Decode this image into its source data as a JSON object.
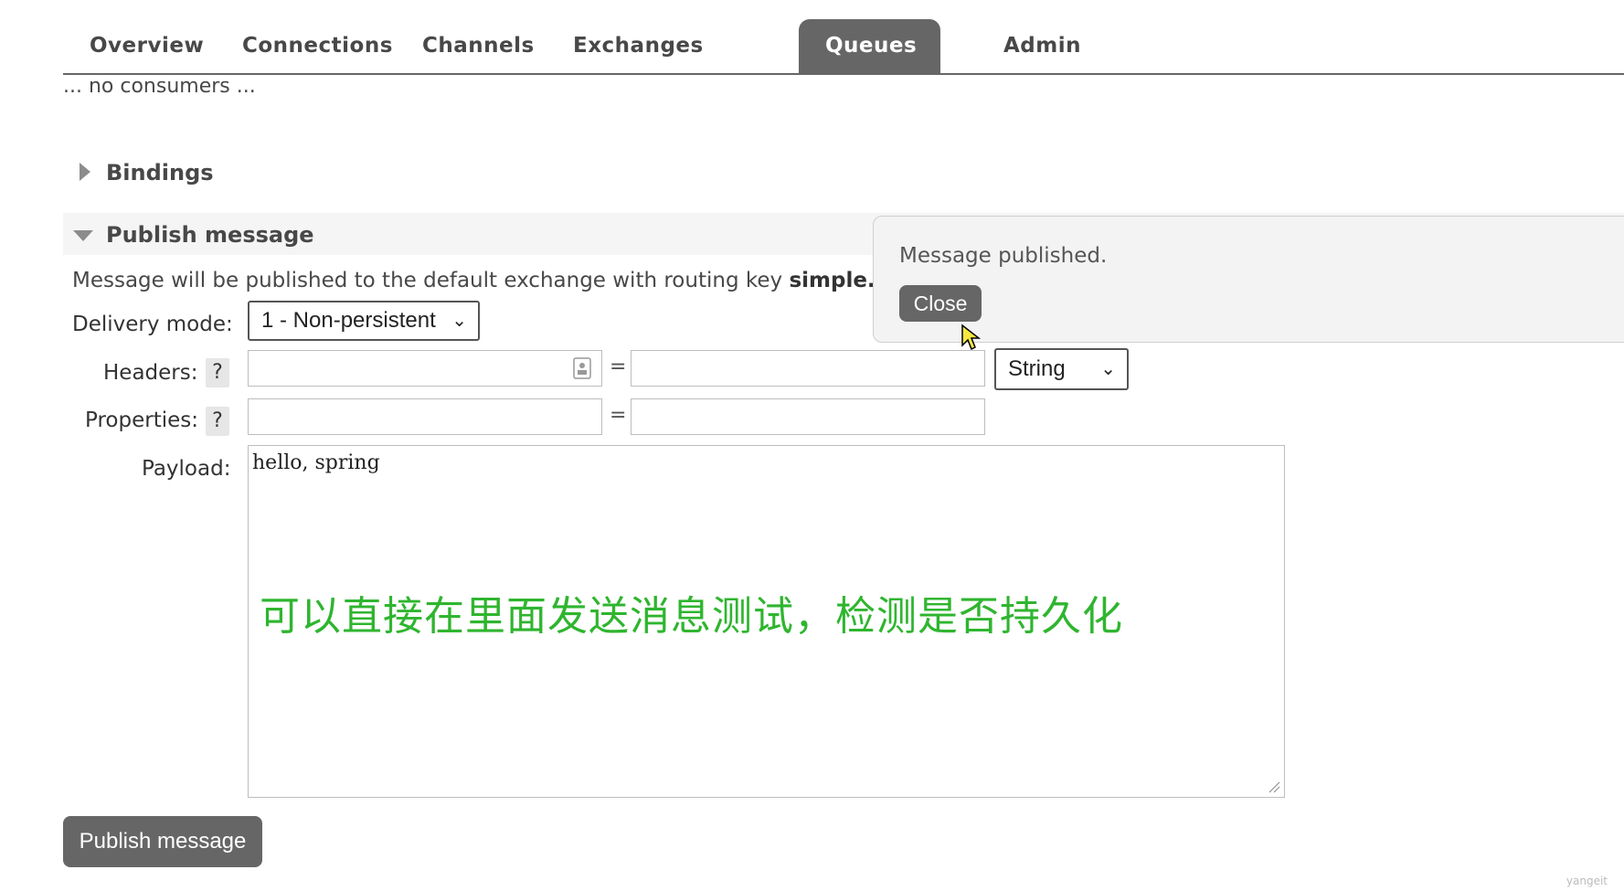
{
  "tabs": [
    {
      "label": "Overview"
    },
    {
      "label": "Connections"
    },
    {
      "label": "Channels"
    },
    {
      "label": "Exchanges"
    },
    {
      "label": "Queues",
      "active": true
    },
    {
      "label": "Admin"
    }
  ],
  "consumers_text": "... no consumers ...",
  "bindings_title": "Bindings",
  "publish": {
    "title": "Publish message",
    "info_prefix": "Message will be published to the default exchange with routing key ",
    "routing_key": "simple.q",
    "delivery_mode_label": "Delivery mode:",
    "delivery_mode_value": "1 - Non-persistent",
    "headers_label": "Headers:",
    "properties_label": "Properties:",
    "help_glyph": "?",
    "equals": "=",
    "header_type_value": "String",
    "payload_label": "Payload:",
    "payload_value": "hello, spring",
    "button_label": "Publish message"
  },
  "popup": {
    "message": "Message published.",
    "close_label": "Close"
  },
  "caption": "可以直接在里面发送消息测试，检测是否持久化",
  "watermark": "yangeit",
  "colors": {
    "tab_active_bg": "#666666",
    "caption": "#2fb52f",
    "button_bg": "#666666"
  }
}
